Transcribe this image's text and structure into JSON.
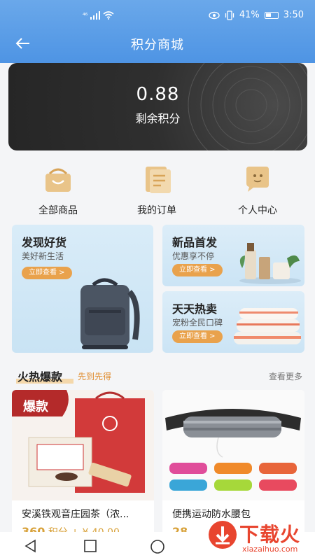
{
  "status_bar": {
    "network": "⁴⁶",
    "battery_percent": "41%",
    "time": "3:50"
  },
  "header": {
    "title": "积分商城"
  },
  "points": {
    "value": "0.88",
    "label": "剩余积分"
  },
  "quick_nav": [
    {
      "label": "全部商品",
      "icon": "basket-icon"
    },
    {
      "label": "我的订单",
      "icon": "order-list-icon"
    },
    {
      "label": "个人中心",
      "icon": "user-chat-icon"
    }
  ],
  "promos": {
    "discover": {
      "title": "发现好货",
      "subtitle": "美好新生活",
      "button": "立即查看 >"
    },
    "new_arrivals": {
      "title": "新品首发",
      "subtitle": "优惠享不停",
      "button": "立即查看 >"
    },
    "daily_hot": {
      "title": "天天热卖",
      "subtitle": "宠粉全民口碑",
      "button": "立即查看 >"
    }
  },
  "hot_section": {
    "title": "火热爆款",
    "subtitle": "先到先得",
    "more": "查看更多"
  },
  "products": [
    {
      "name": "安溪铁观音庄园茶（浓...",
      "price_prefix": "360",
      "price_suffix": " 积分 + ¥ 40.00",
      "badge": "爆款"
    },
    {
      "name": "便携运动防水腰包",
      "price_prefix": "28",
      "price_suffix": ""
    }
  ],
  "watermark": {
    "text": "下载火",
    "domain": "xiazaihuo.com"
  },
  "colors": {
    "header_blue": "#5a9ee7",
    "accent_orange": "#e9a24c",
    "price_gold": "#d8a23b",
    "card_dark": "#2f2f2f"
  }
}
